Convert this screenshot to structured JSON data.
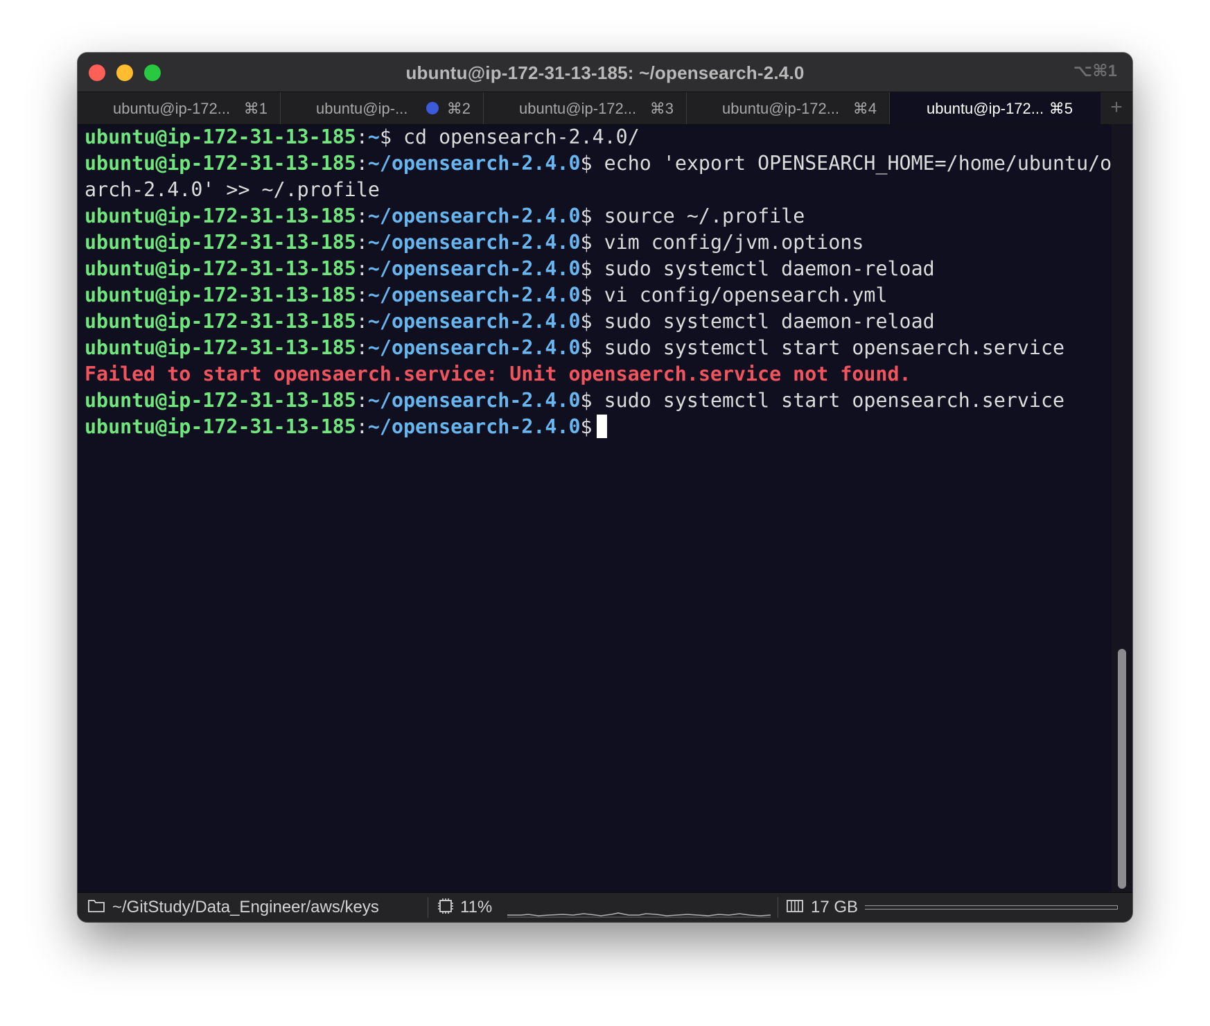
{
  "window": {
    "title": "ubuntu@ip-172-31-13-185: ~/opensearch-2.4.0",
    "shortcut_hint": "⌥⌘1"
  },
  "tabs": [
    {
      "label": "ubuntu@ip-172...",
      "key": "⌘1",
      "active": false
    },
    {
      "label": "ubuntu@ip-...",
      "key": "⌘2",
      "active": false,
      "activity": true
    },
    {
      "label": "ubuntu@ip-172...",
      "key": "⌘3",
      "active": false
    },
    {
      "label": "ubuntu@ip-172...",
      "key": "⌘4",
      "active": false
    },
    {
      "label": "ubuntu@ip-172...",
      "key": "⌘5",
      "active": true
    }
  ],
  "new_tab_symbol": "+",
  "terminal": {
    "prompt_user": "ubuntu@ip-172-31-13-185",
    "lines": [
      {
        "type": "prompt",
        "path": "~",
        "cmd": " cd opensearch-2.4.0/"
      },
      {
        "type": "prompt",
        "path": "~/opensearch-2.4.0",
        "cmd": " echo 'export OPENSEARCH_HOME=/home/ubuntu/opense"
      },
      {
        "type": "output",
        "text": "arch-2.4.0' >> ~/.profile"
      },
      {
        "type": "prompt",
        "path": "~/opensearch-2.4.0",
        "cmd": " source ~/.profile"
      },
      {
        "type": "prompt",
        "path": "~/opensearch-2.4.0",
        "cmd": " vim config/jvm.options"
      },
      {
        "type": "prompt",
        "path": "~/opensearch-2.4.0",
        "cmd": " sudo systemctl daemon-reload"
      },
      {
        "type": "prompt",
        "path": "~/opensearch-2.4.0",
        "cmd": " vi config/opensearch.yml"
      },
      {
        "type": "prompt",
        "path": "~/opensearch-2.4.0",
        "cmd": " sudo systemctl daemon-reload"
      },
      {
        "type": "prompt",
        "path": "~/opensearch-2.4.0",
        "cmd": " sudo systemctl start opensaerch.service"
      },
      {
        "type": "error",
        "text": "Failed to start opensaerch.service: Unit opensaerch.service not found."
      },
      {
        "type": "prompt",
        "path": "~/opensearch-2.4.0",
        "cmd": " sudo systemctl start opensearch.service"
      },
      {
        "type": "prompt",
        "path": "~/opensearch-2.4.0",
        "cmd": "",
        "cursor": true
      }
    ]
  },
  "status": {
    "folder_icon": "folder-icon",
    "path": "~/GitStudy/Data_Engineer/aws/keys",
    "cpu_icon": "cpu-icon",
    "cpu": "11%",
    "memory_icon": "memory-icon",
    "memory": "17 GB"
  },
  "colors": {
    "user": "#6fe77d",
    "path": "#68b6ef",
    "error": "#f2545e",
    "background": "#100f1f"
  }
}
